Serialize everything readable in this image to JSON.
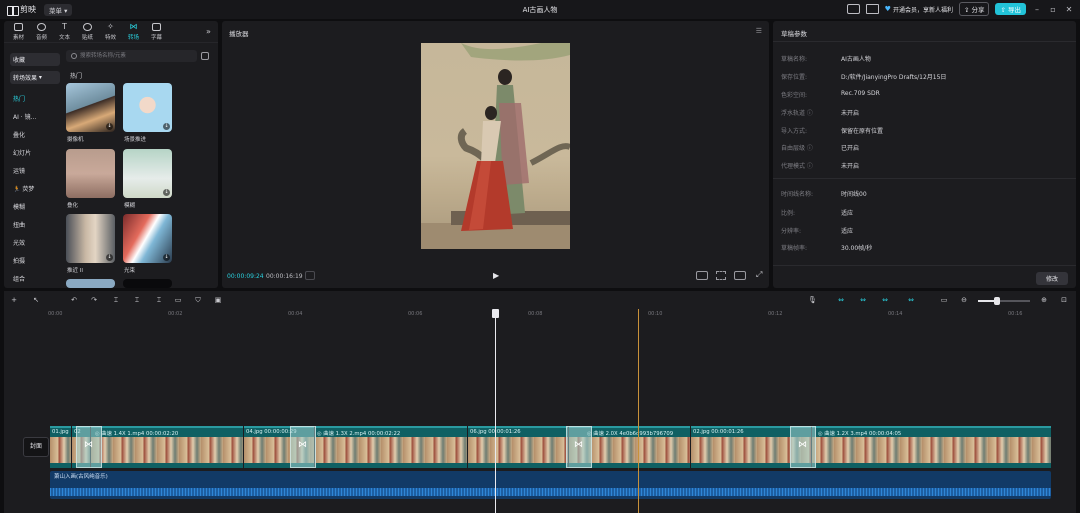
{
  "titlebar": {
    "app_name": "剪映",
    "menu_label": "菜单",
    "window_title": "AI古画人物",
    "promo_text": "开通会员，享新人福利",
    "share_label": "分享",
    "export_label": "导出"
  },
  "media_tabs": [
    {
      "label": "素材"
    },
    {
      "label": "音频"
    },
    {
      "label": "文本"
    },
    {
      "label": "贴纸"
    },
    {
      "label": "特效"
    },
    {
      "label": "转场"
    },
    {
      "label": "字幕"
    }
  ],
  "categories": {
    "collect": "收藏",
    "transition_effects": "转场效果",
    "items": [
      "热门",
      "AI · 镜...",
      "叠化",
      "幻灯片",
      "运镜",
      "🏃 荧梦",
      "模糊",
      "扭曲",
      "光效",
      "拍摄",
      "组合"
    ]
  },
  "search": {
    "placeholder": "搜索转场名称/元素"
  },
  "section_label": "热门",
  "thumbs": [
    {
      "label": "摄像机"
    },
    {
      "label": "场景推进"
    },
    {
      "label": "叠化"
    },
    {
      "label": "模糊"
    },
    {
      "label": "推近 II"
    },
    {
      "label": "光束"
    }
  ],
  "player": {
    "title": "播放器",
    "current_time": "00:00:09:24",
    "total_time": "00:00:16:19"
  },
  "params": {
    "title": "草稿参数",
    "rows": [
      {
        "label": "草稿名称:",
        "value": "AI古画人物"
      },
      {
        "label": "保存位置:",
        "value": "D:/软件/JianyingPro Drafts/12月15日"
      },
      {
        "label": "色彩空间:",
        "value": "Rec.709 SDR"
      },
      {
        "label": "浮水轨道 ⓘ",
        "value": "未开启"
      },
      {
        "label": "导入方式:",
        "value": "保留在原有位置"
      },
      {
        "label": "自由层级 ⓘ",
        "value": "已开启"
      },
      {
        "label": "代理模式 ⓘ",
        "value": "未开启"
      }
    ],
    "rows2": [
      {
        "label": "时间线名称:",
        "value": "时间线00"
      },
      {
        "label": "比例:",
        "value": "适应"
      },
      {
        "label": "分辨率:",
        "value": "适应"
      },
      {
        "label": "草稿帧率:",
        "value": "30.00帧/秒"
      }
    ],
    "modify_label": "修改"
  },
  "ruler": [
    "00:00",
    "00:02",
    "00:04",
    "00:06",
    "00:08",
    "00:10",
    "00:12",
    "00:14",
    "00:16"
  ],
  "clips": [
    {
      "label": "01.jpg"
    },
    {
      "label": "02"
    },
    {
      "label": "◎ 曲速 1.4X  1.mp4  00:00:02:20"
    },
    {
      "label": "04.jpg  00:00:00:29"
    },
    {
      "label": "◎ 曲速 1.3X  2.mp4  00:00:02:22"
    },
    {
      "label": "06.jpg  00:00:01:26"
    },
    {
      "label": "◎ 曲速 2.0X  4e0b6d993b796709"
    },
    {
      "label": "02.jpg  00:00:01:26"
    },
    {
      "label": "◎ 曲速 1.2X  3.mp4  00:00:04:05"
    }
  ],
  "cover_label": "封面",
  "audio_label": "萧山入画(古风纯音乐)",
  "colors": {
    "accent": "#22c3d8",
    "panel": "#1c1c1f",
    "clip": "#0f6063",
    "audio": "#123a66"
  }
}
